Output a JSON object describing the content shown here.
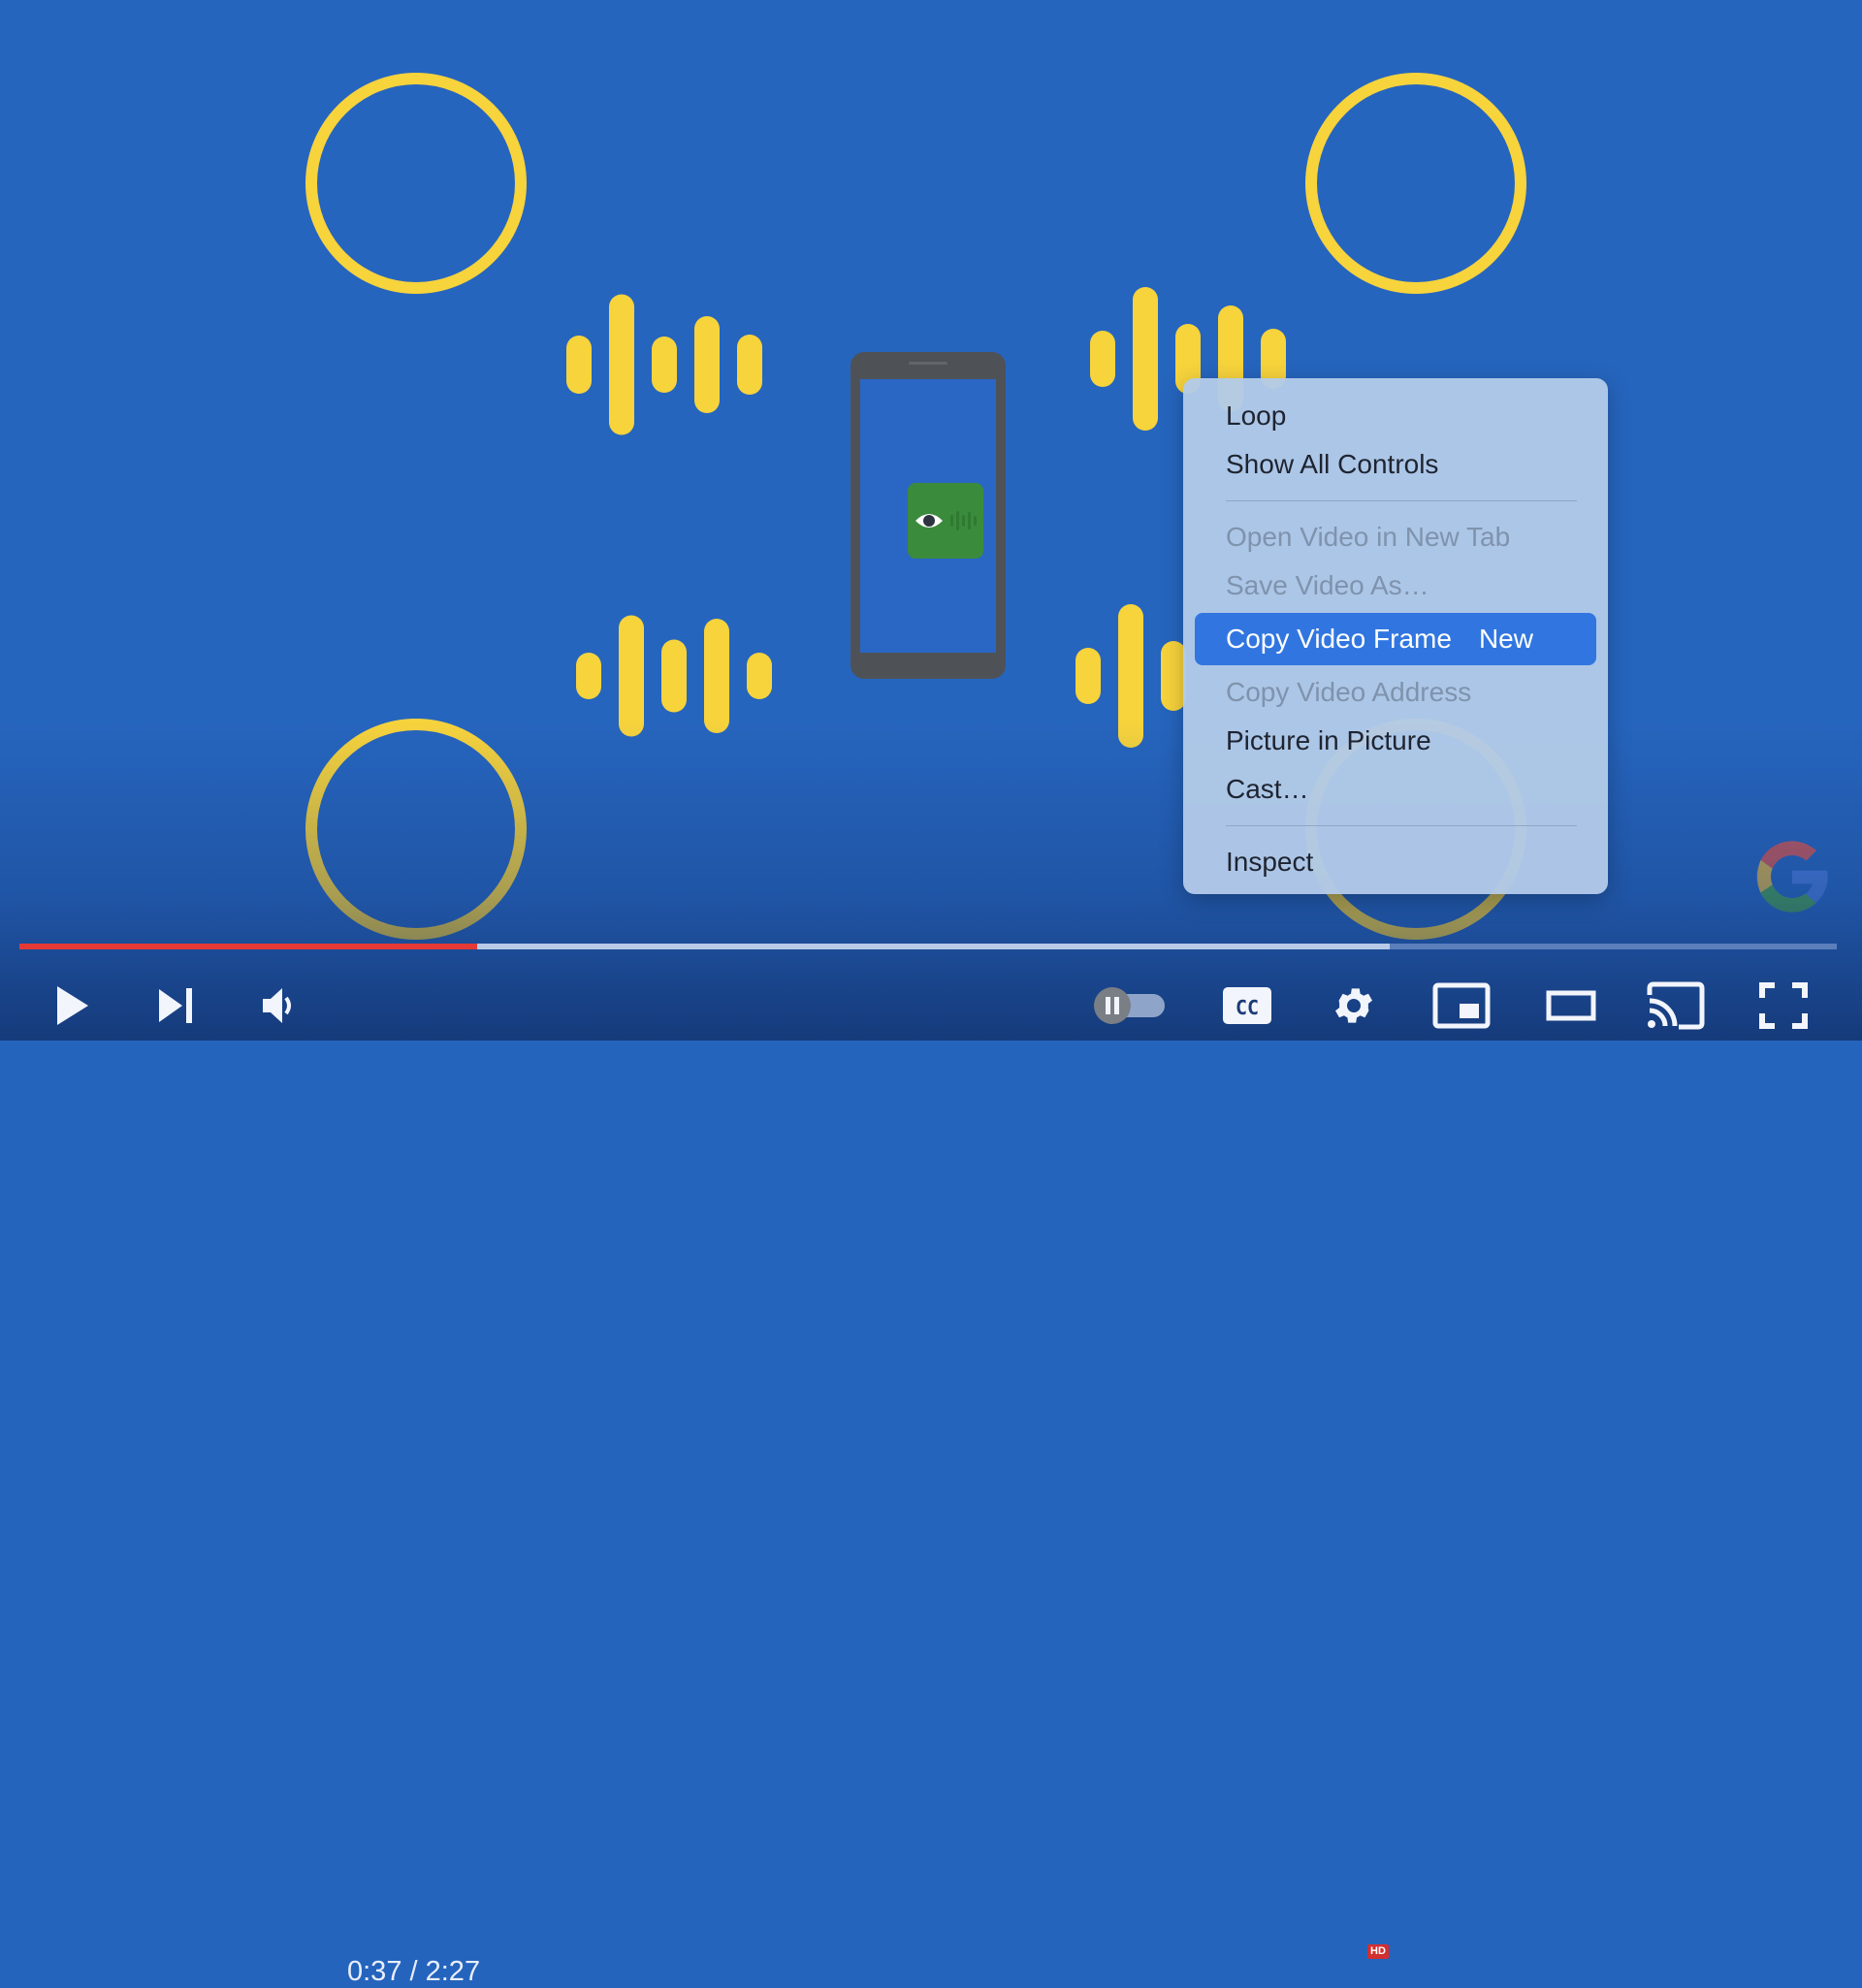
{
  "video": {
    "background_color": "#2665be",
    "accent_yellow": "#f7d33c",
    "phone_app": {
      "icon": "eye-icon",
      "tile_color": "#3b8b3c"
    },
    "watermark": "google-logo"
  },
  "player": {
    "progress": {
      "played_fraction": 0.252,
      "buffered_fraction": 0.754,
      "played_color": "#e53935"
    },
    "time": {
      "current": "0:37",
      "duration": "2:27",
      "display": "0:37 / 2:27"
    },
    "controls": {
      "play": {
        "icon": "play-icon",
        "label": "Play"
      },
      "next": {
        "icon": "skip-next-icon",
        "label": "Next"
      },
      "volume": {
        "icon": "volume-icon",
        "label": "Mute"
      },
      "autoplay": {
        "icon": "autoplay-toggle-icon",
        "state": "off"
      },
      "captions": {
        "icon": "cc-icon",
        "label": "CC"
      },
      "settings": {
        "icon": "gear-icon",
        "badge": "HD",
        "badge_color": "#d32f2f"
      },
      "miniplayer": {
        "icon": "miniplayer-icon"
      },
      "theater": {
        "icon": "theater-mode-icon"
      },
      "cast": {
        "icon": "cast-icon"
      },
      "fullscreen": {
        "icon": "fullscreen-icon"
      }
    }
  },
  "context_menu": {
    "highlight_color": "#3176e0",
    "groups": [
      [
        {
          "label": "Loop",
          "enabled": true
        },
        {
          "label": "Show All Controls",
          "enabled": true
        }
      ],
      [
        {
          "label": "Open Video in New Tab",
          "enabled": false
        },
        {
          "label": "Save Video As…",
          "enabled": false
        },
        {
          "label": "Copy Video Frame",
          "enabled": true,
          "highlighted": true,
          "badge": "New"
        },
        {
          "label": "Copy Video Address",
          "enabled": false
        },
        {
          "label": "Picture in Picture",
          "enabled": true
        },
        {
          "label": "Cast…",
          "enabled": true
        }
      ],
      [
        {
          "label": "Inspect",
          "enabled": true
        }
      ]
    ]
  }
}
